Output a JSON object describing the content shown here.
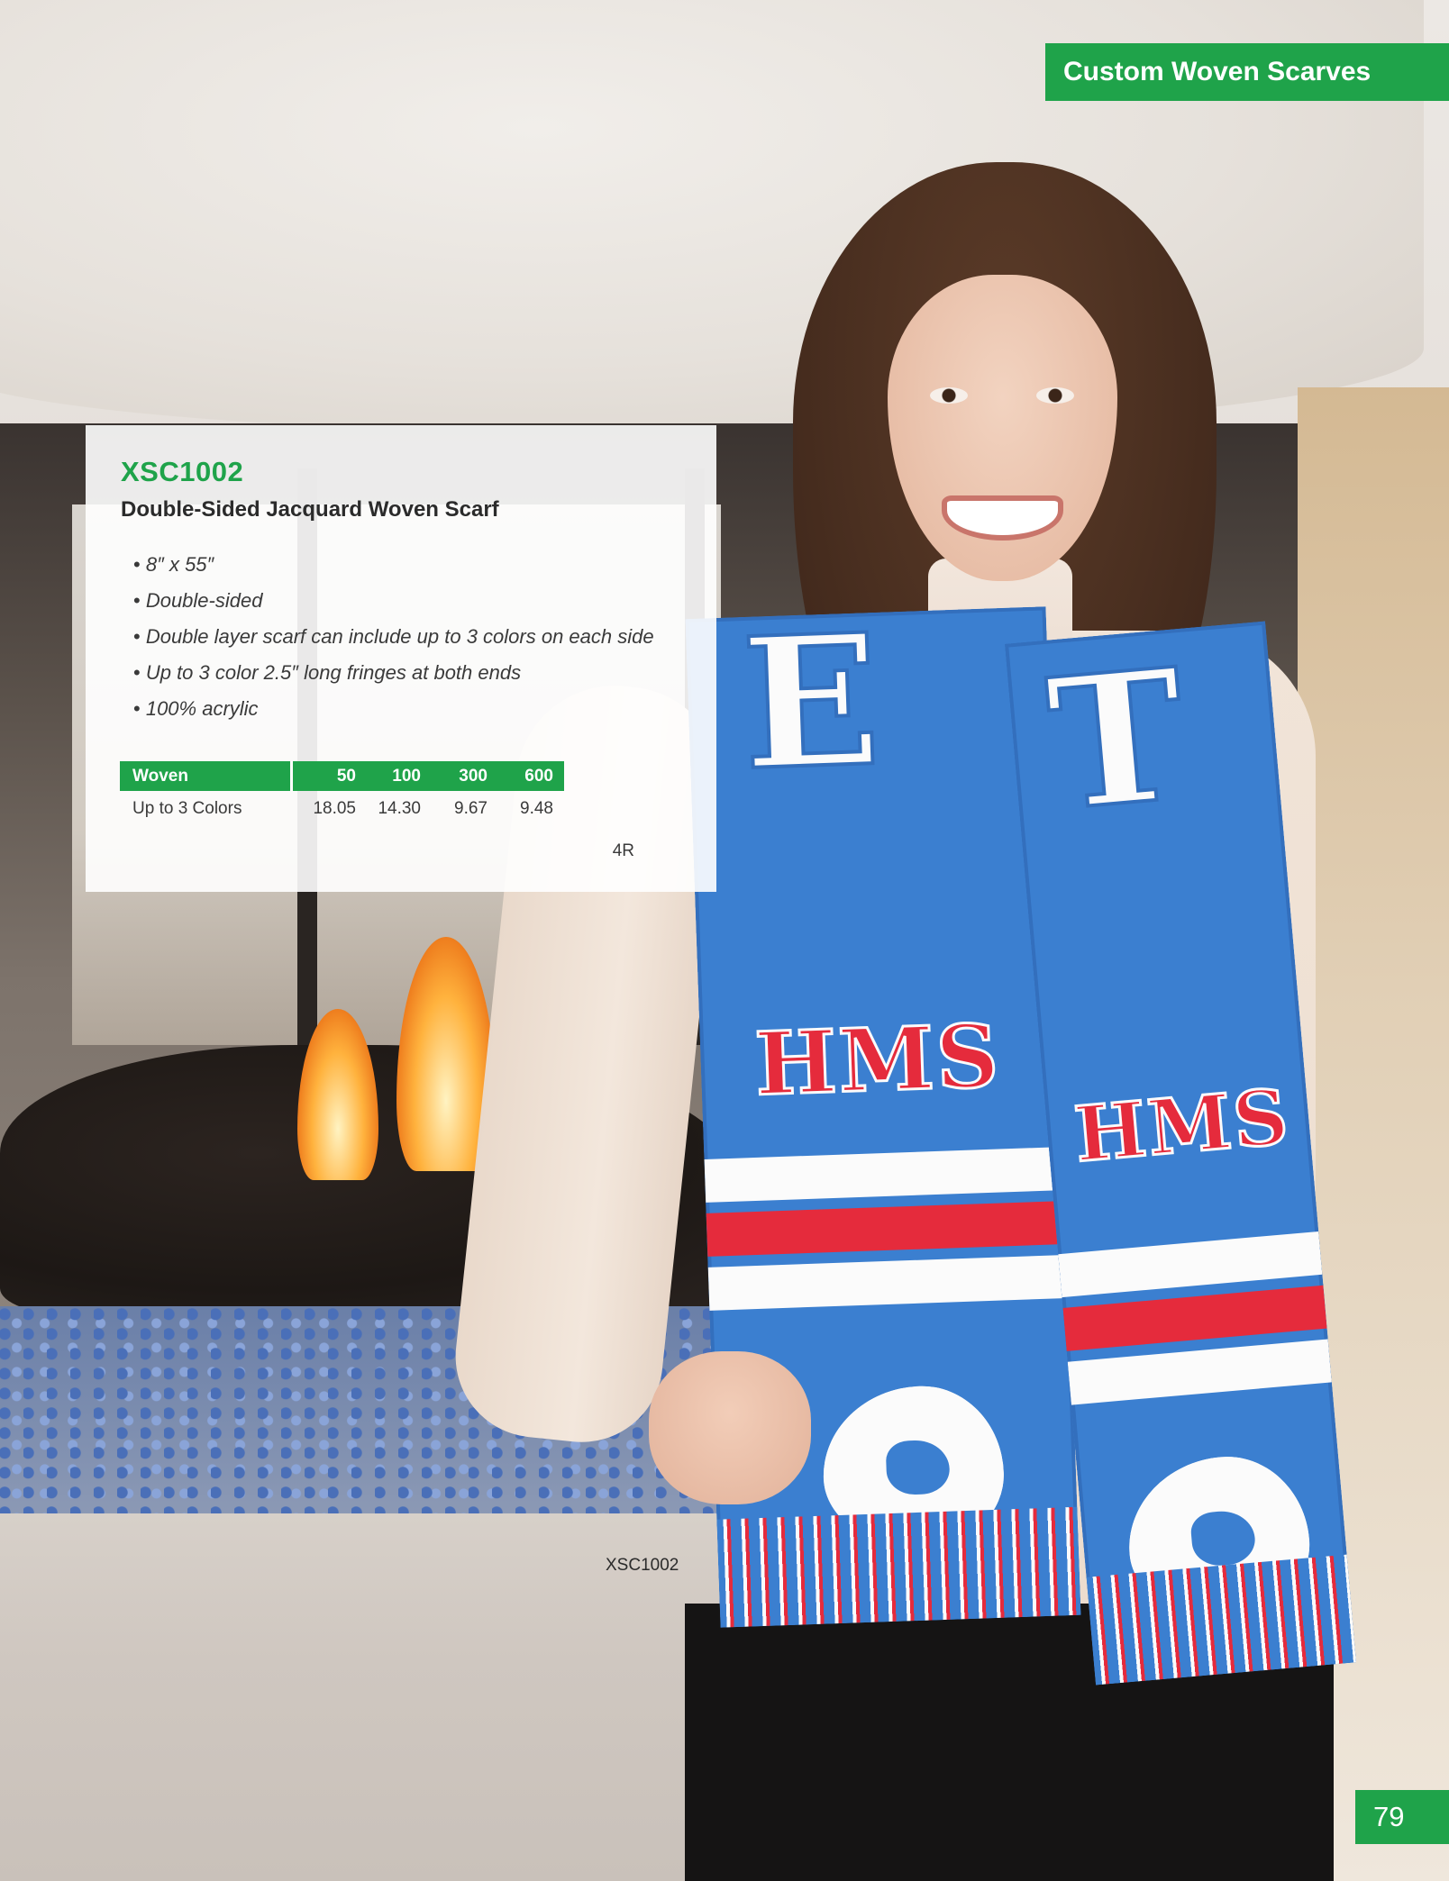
{
  "header": {
    "banner_label": "Custom Woven Scarves"
  },
  "product": {
    "sku": "XSC1002",
    "name": "Double-Sided Jacquard Woven Scarf",
    "features": [
      "8″ x 55″",
      "Double-sided",
      "Double layer scarf can include up to 3 colors on each side",
      "Up to 3 color 2.5″ long fringes at both ends",
      "100% acrylic"
    ]
  },
  "pricing": {
    "header_label": "Woven",
    "quantities": [
      "50",
      "100",
      "300",
      "600"
    ],
    "rows": [
      {
        "label": "Up to 3 Colors",
        "prices": [
          "18.05",
          "14.30",
          "9.67",
          "9.48"
        ]
      }
    ],
    "price_code": "4R"
  },
  "photo": {
    "caption": "XSC1002",
    "scarf_text": "HMS",
    "colors": {
      "scarf_blue": "#3b7fd0",
      "scarf_red": "#e52b3c",
      "scarf_white": "#fbfbfb"
    }
  },
  "footer": {
    "page_number": "79"
  },
  "theme": {
    "accent": "#1fa34a"
  }
}
